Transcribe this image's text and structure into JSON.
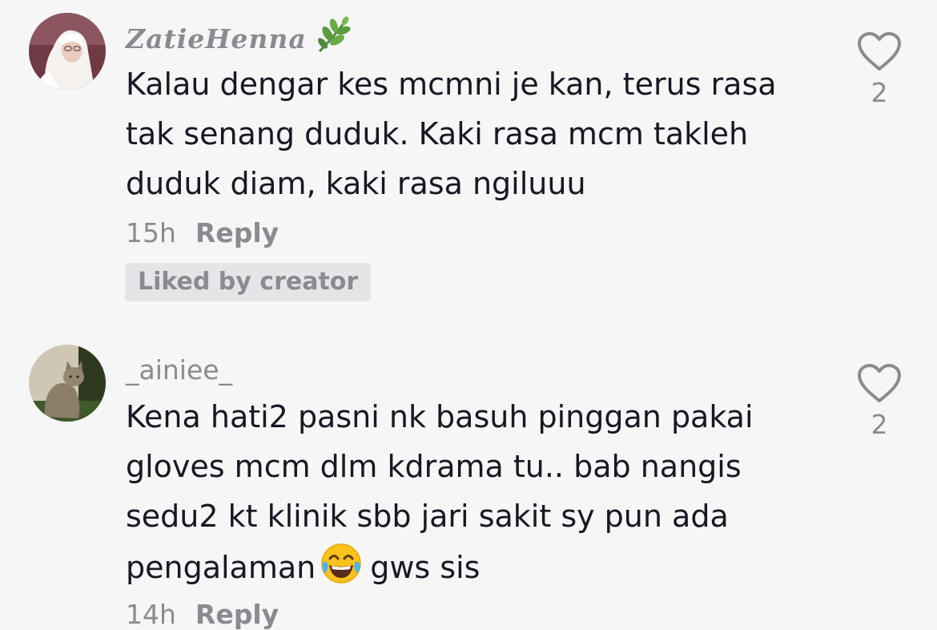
{
  "comments": [
    {
      "username": "ZatieHenna",
      "username_icon": "leaf-icon",
      "lines": [
        "Kalau dengar kes mcmni je kan, terus rasa",
        "tak senang duduk. Kaki rasa mcm takleh",
        "duduk diam, kaki rasa ngiluuu"
      ],
      "time": "15h",
      "reply_label": "Reply",
      "badge": "Liked by creator",
      "likes": "2",
      "avatar_icon": "avatar-hijab-woman"
    },
    {
      "username": "_ainiee_",
      "lines": [
        "Kena hati2 pasni nk basuh pinggan pakai",
        "gloves mcm dlm kdrama tu.. bab nangis",
        "sedu2 kt klinik sbb jari sakit sy pun ada",
        "pengalaman"
      ],
      "line4_suffix": "gws sis",
      "line4_emoji": "tears-of-joy-emoji",
      "time": "14h",
      "reply_label": "Reply",
      "likes": "2",
      "avatar_icon": "avatar-cat"
    }
  ],
  "colors": {
    "background": "#f6f6f6",
    "text_primary": "#161823",
    "text_secondary": "#8a8b91",
    "badge_bg": "#e5e5e7"
  }
}
